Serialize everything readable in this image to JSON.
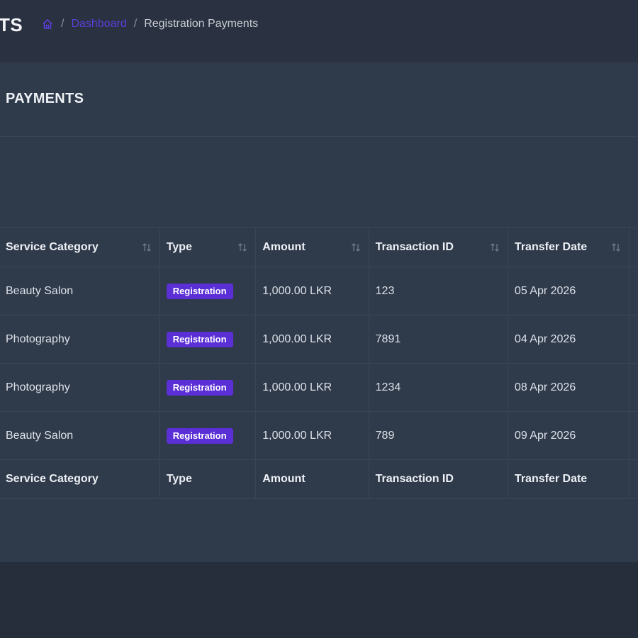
{
  "header": {
    "title_fragment": "TS",
    "breadcrumb": {
      "home_icon": "home-icon",
      "separator": "/",
      "dashboard": "Dashboard",
      "current": "Registration Payments"
    }
  },
  "card": {
    "title": "PAYMENTS"
  },
  "table": {
    "columns": [
      "Service Category",
      "Type",
      "Amount",
      "Transaction ID",
      "Transfer Date"
    ],
    "rows": [
      {
        "service_category": "Beauty Salon",
        "type": "Registration",
        "amount": "1,000.00 LKR",
        "transaction_id": "123",
        "transfer_date": "05 Apr 2026"
      },
      {
        "service_category": "Photography",
        "type": "Registration",
        "amount": "1,000.00 LKR",
        "transaction_id": "7891",
        "transfer_date": "04 Apr 2026"
      },
      {
        "service_category": "Photography",
        "type": "Registration",
        "amount": "1,000.00 LKR",
        "transaction_id": "1234",
        "transfer_date": "08 Apr 2026"
      },
      {
        "service_category": "Beauty Salon",
        "type": "Registration",
        "amount": "1,000.00 LKR",
        "transaction_id": "789",
        "transfer_date": "09 Apr 2026"
      }
    ],
    "sort_icon": "sort-arrows-icon"
  },
  "colors": {
    "accent": "#5a2fd6",
    "link": "#5b3fd8",
    "background": "#262d3b",
    "card": "#2f3a4b"
  }
}
